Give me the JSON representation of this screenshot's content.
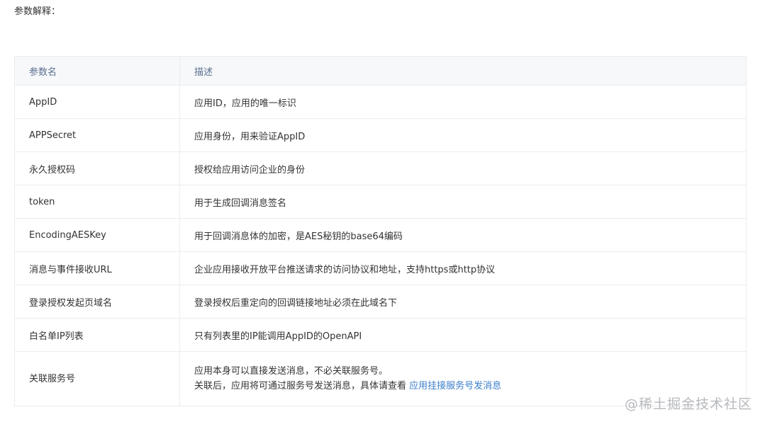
{
  "intro": "参数解释：",
  "table": {
    "headers": [
      "参数名",
      "描述"
    ],
    "rows": [
      {
        "name": "AppID",
        "desc": "应用ID，应用的唯一标识"
      },
      {
        "name": "APPSecret",
        "desc": "应用身份，用来验证AppID"
      },
      {
        "name": "永久授权码",
        "desc": "授权给应用访问企业的身份"
      },
      {
        "name": "token",
        "desc": "用于生成回调消息签名"
      },
      {
        "name": "EncodingAESKey",
        "desc": "用于回调消息体的加密，是AES秘钥的base64编码"
      },
      {
        "name": "消息与事件接收URL",
        "desc": "企业应用接收开放平台推送请求的访问协议和地址，支持https或http协议"
      },
      {
        "name": "登录授权发起页域名",
        "desc": "登录授权后重定向的回调链接地址必须在此域名下"
      },
      {
        "name": "白名单IP列表",
        "desc": "只有列表里的IP能调用AppID的OpenAPI"
      }
    ],
    "last_row": {
      "name": "关联服务号",
      "line1": "应用本身可以直接发送消息，不必关联服务号。",
      "line2": "关联后，应用将可通过服务号发送消息，具体请查看 ",
      "link": "应用挂接服务号发消息"
    }
  },
  "watermark": "@稀土掘金技术社区",
  "colors": {
    "header_bg": "#f7f8fa",
    "header_text": "#5a6f8f",
    "border": "#ececec",
    "link": "#3b7ecb"
  }
}
